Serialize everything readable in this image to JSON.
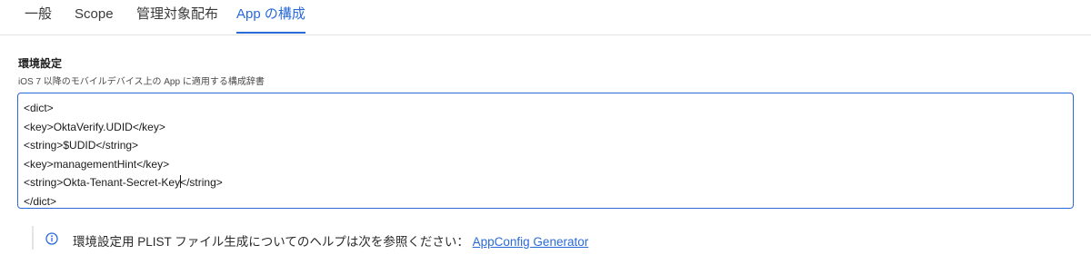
{
  "tabs": [
    {
      "label": "一般"
    },
    {
      "label": "Scope"
    },
    {
      "label": "管理対象配布"
    },
    {
      "label": "App の構成"
    }
  ],
  "active_tab": "App の構成",
  "config": {
    "title": "環境設定",
    "description": "iOS 7 以降のモバイルデバイス上の App に適用する構成辞書",
    "lines": [
      "<dict>",
      "<key>OktaVerify.UDID</key>",
      "<string>$UDID</string>",
      "<key>managementHint</key>",
      "<string>Okta-Tenant-Secret-Key",
      "</string>",
      "</dict>"
    ]
  },
  "help": {
    "text": "環境設定用 PLIST ファイル生成についてのヘルプは次を参照ください：",
    "link_label": "AppConfig Generator"
  },
  "colors": {
    "accent": "#2a6ad8",
    "text": "#1f1f1f",
    "border": "#e3e3e3"
  },
  "icons": {
    "help": "info-circle-icon"
  }
}
